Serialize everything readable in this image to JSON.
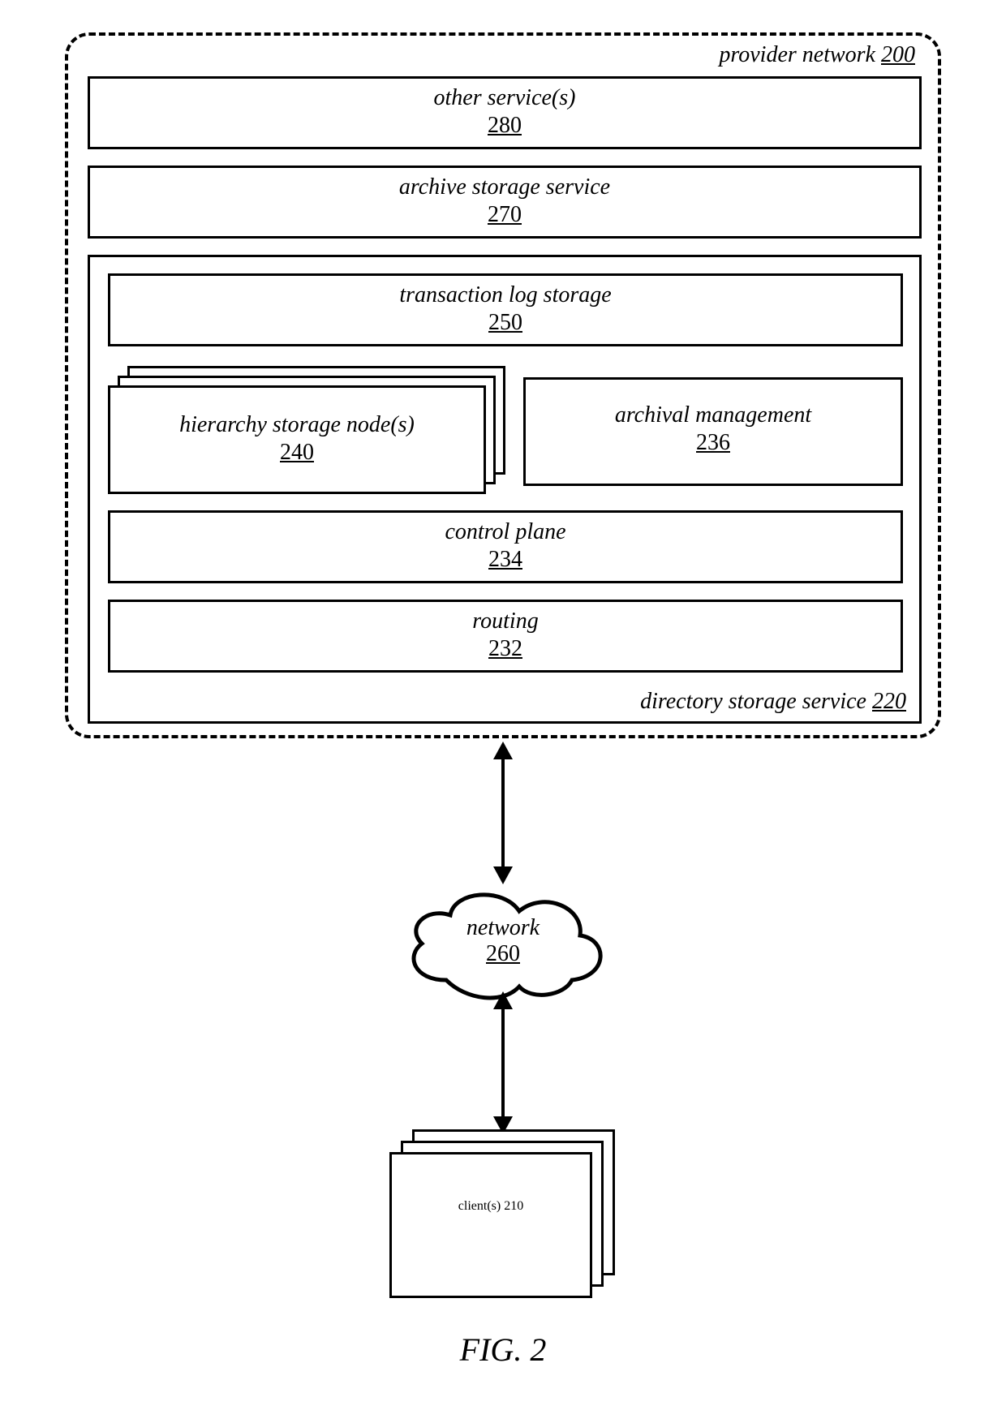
{
  "outer": {
    "label": "provider network",
    "num": "200"
  },
  "other_svc": {
    "label": "other service(s)",
    "num": "280"
  },
  "archive_svc": {
    "label": "archive storage service",
    "num": "270"
  },
  "dir_svc": {
    "label": "directory storage service",
    "num": "220"
  },
  "txlog": {
    "label": "transaction log storage",
    "num": "250"
  },
  "hsn": {
    "label": "hierarchy storage node(s)",
    "num": "240"
  },
  "archmgmt": {
    "label": "archival management",
    "num": "236"
  },
  "ctrlplane": {
    "label": "control plane",
    "num": "234"
  },
  "routing": {
    "label": "routing",
    "num": "232"
  },
  "network": {
    "label": "network",
    "num": "260"
  },
  "clients": {
    "label": "client(s)",
    "num": "210"
  },
  "caption": "FIG. 2"
}
